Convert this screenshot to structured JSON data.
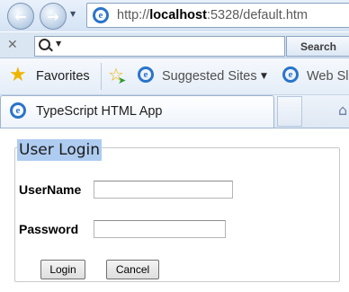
{
  "browser": {
    "address": {
      "prefix": "http://",
      "host": "localhost",
      "suffix": ":5328/default.htm"
    },
    "search": {
      "button_label": "Search",
      "query": ""
    },
    "favorites_bar": {
      "favorites_label": "Favorites",
      "suggested_sites_label": "Suggested Sites",
      "web_slice_label": "Web Sl"
    },
    "tab": {
      "title": "TypeScript HTML App"
    },
    "icons": {
      "back": "back-arrow-icon",
      "forward": "forward-arrow-icon",
      "site": "ie-logo-icon",
      "close": "close-x-icon",
      "search": "magnifier-icon",
      "favorites": "star-icon",
      "add_favorites": "add-to-favorites-icon",
      "home": "home-icon"
    },
    "colors": {
      "chrome_blue": "#dbe6f3",
      "legend_highlight": "#aecbf0"
    }
  },
  "page": {
    "login": {
      "legend": "User Login",
      "username_label": "UserName",
      "username_value": "",
      "password_label": "Password",
      "password_value": "",
      "login_button": "Login",
      "cancel_button": "Cancel"
    }
  }
}
